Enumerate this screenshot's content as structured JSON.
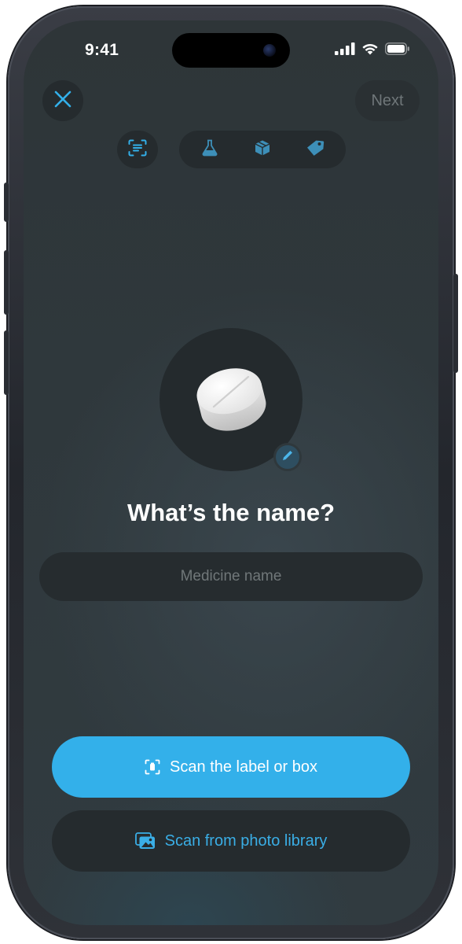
{
  "status_bar": {
    "time": "9:41",
    "icons": [
      "cellular-signal-icon",
      "wifi-icon",
      "battery-icon"
    ]
  },
  "header": {
    "close_icon": "close-icon",
    "next_label": "Next"
  },
  "mode_selector": {
    "single": {
      "icon": "scan-text-icon"
    },
    "group": [
      {
        "icon": "flask-icon"
      },
      {
        "icon": "box-icon"
      },
      {
        "icon": "tag-icon"
      }
    ]
  },
  "illustration": {
    "icon": "pill-icon",
    "edit_icon": "pencil-icon"
  },
  "main": {
    "heading": "What’s the name?",
    "input_placeholder": "Medicine name",
    "input_value": ""
  },
  "actions": {
    "scan_label": "Scan the label or box",
    "scan_icon": "scan-document-icon",
    "library_label": "Scan from photo library",
    "library_icon": "photo-library-icon"
  },
  "colors": {
    "accent": "#33b0ea",
    "background": "#2f383c",
    "surface": "#252b2e",
    "muted_text": "#707779"
  }
}
